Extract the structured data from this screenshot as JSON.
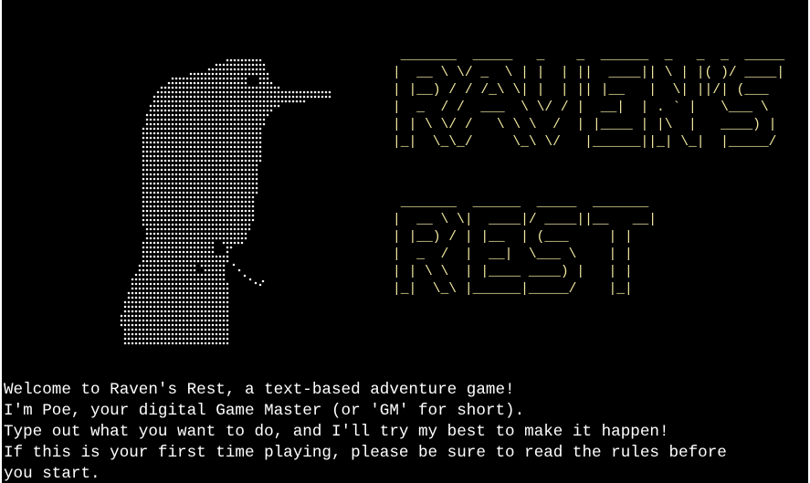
{
  "terminal": {
    "background_color": "#000000",
    "text_color": "#ffffff",
    "art": {
      "dot_color": "#ffffff",
      "title_color": "#f2e9a0",
      "raven_icon": "raven-ascii-art",
      "title_lines_raven": [
        " _______  _____   _    _  ______  _   _  _  _____ ",
        "|  __ \\ \\/ _  \\ | |  | ||  ____|| \\ | |( )/ ____|",
        "| |__) / / /_\\ \\| |  | || |__   |  \\| ||/| (___  ",
        "|  _  / /  ___  \\ \\/ / |  __|  | . ` |   \\___ \\ ",
        "| | \\ \\/ /   \\ \\ \\  /  | |____ | |\\  |   ____) |",
        "|_|  \\_\\_/     \\_\\ \\/   |______||_| \\_|  |_____/ "
      ],
      "title_lines_rest": [
        " _______  ______  _____  _______ ",
        "|  __ \\ \\|  ____|/ ____||__   __|",
        "| |__) / | |__  | (___     | |   ",
        "|  _  /  |  __|  \\___ \\    | |   ",
        "| | \\ \\  | |____ ____) |   | |   ",
        "|_|  \\_\\ |______|_____/    |_|   "
      ]
    },
    "messages": [
      "Welcome to Raven's Rest, a text-based adventure game!",
      "I'm Poe, your digital Game Master (or 'GM' for short).",
      "Type out what you want to do, and I'll try my best to make it happen!",
      "If this is your first time playing, please be sure to read the rules before",
      "you start."
    ]
  }
}
